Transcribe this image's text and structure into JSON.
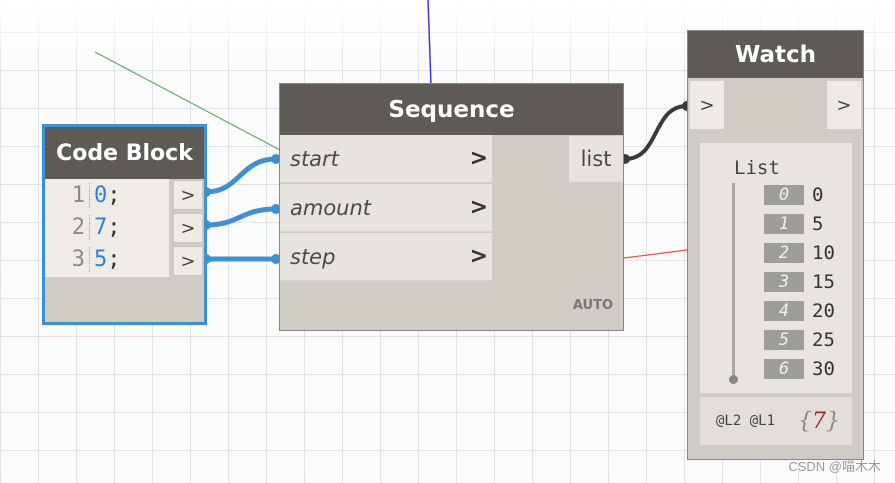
{
  "code_block": {
    "title": "Code Block",
    "lines": [
      {
        "num": "1",
        "value": "0",
        "end": ";"
      },
      {
        "num": "2",
        "value": "7",
        "end": ";"
      },
      {
        "num": "3",
        "value": "5",
        "end": ";"
      }
    ],
    "port_label": ">"
  },
  "sequence": {
    "title": "Sequence",
    "inputs": [
      "start",
      "amount",
      "step"
    ],
    "chevron": ">",
    "output": "list",
    "lacing": "AUTO"
  },
  "watch": {
    "title": "Watch",
    "in_port": ">",
    "out_port": ">",
    "list_label": "List",
    "items": [
      {
        "index": "0",
        "value": "0"
      },
      {
        "index": "1",
        "value": "5"
      },
      {
        "index": "2",
        "value": "10"
      },
      {
        "index": "3",
        "value": "15"
      },
      {
        "index": "4",
        "value": "20"
      },
      {
        "index": "5",
        "value": "25"
      },
      {
        "index": "6",
        "value": "30"
      }
    ],
    "levels": "@L2 @L1",
    "count_open": "{",
    "count": "7",
    "count_close": "}"
  },
  "watermark": "CSDN @喵木木",
  "colors": {
    "wire_blue": "#3d8fd6",
    "wire_dark": "#3a3a3a",
    "header": "#5e5b57"
  }
}
